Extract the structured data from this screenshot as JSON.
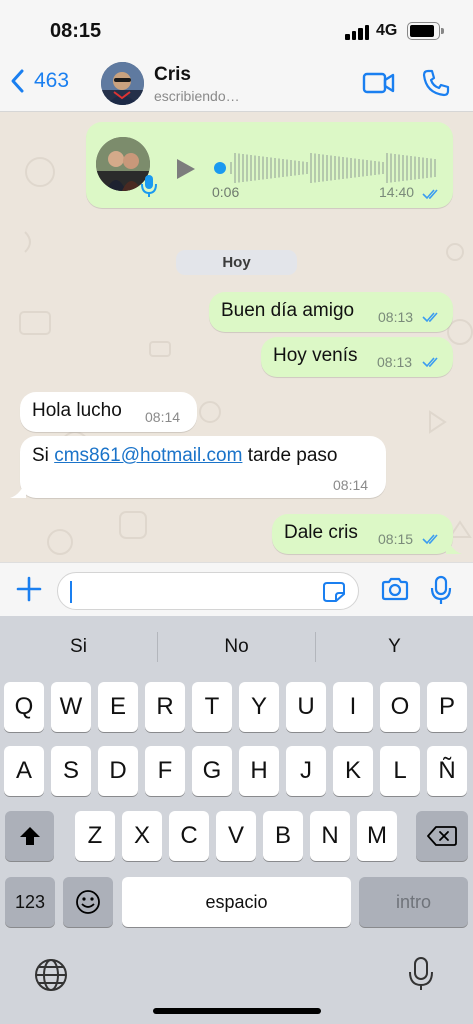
{
  "status": {
    "time": "08:15",
    "network": "4G",
    "battery_level": 0.9
  },
  "header": {
    "back_count": "463",
    "contact_name": "Cris",
    "contact_status": "escribiendo…"
  },
  "messages": {
    "voice": {
      "duration": "0:06",
      "time": "14:40"
    },
    "day_separator": "Hoy",
    "m1": {
      "text": "Buen día amigo",
      "time": "08:13"
    },
    "m2": {
      "text": "Hoy venís",
      "time": "08:13"
    },
    "m3": {
      "text": "Hola lucho",
      "time": "08:14"
    },
    "m4": {
      "prefix": "Si ",
      "link": "cms861@hotmail.com",
      "suffix": " tarde paso",
      "time": "08:14"
    },
    "m5": {
      "text": "Dale cris",
      "time": "08:15"
    }
  },
  "keyboard": {
    "suggestions": [
      "Si",
      "No",
      "Y"
    ],
    "row1": [
      "Q",
      "W",
      "E",
      "R",
      "T",
      "Y",
      "U",
      "I",
      "O",
      "P"
    ],
    "row2": [
      "A",
      "S",
      "D",
      "F",
      "G",
      "H",
      "J",
      "K",
      "L",
      "Ñ"
    ],
    "row3": [
      "Z",
      "X",
      "C",
      "V",
      "B",
      "N",
      "M"
    ],
    "numbers_key": "123",
    "space_key": "espacio",
    "return_key": "intro"
  },
  "colors": {
    "accent": "#1a7ff0",
    "outgoing_bubble": "#dcf8c6",
    "incoming_bubble": "#ffffff",
    "chat_bg": "#ece5dc"
  },
  "icons": [
    "chevron-left-icon",
    "video-call-icon",
    "phone-icon",
    "play-icon",
    "mic-icon",
    "double-check-icon",
    "plus-icon",
    "sticker-icon",
    "camera-icon",
    "shift-icon",
    "backspace-icon",
    "emoji-icon",
    "globe-icon",
    "dictation-icon"
  ]
}
